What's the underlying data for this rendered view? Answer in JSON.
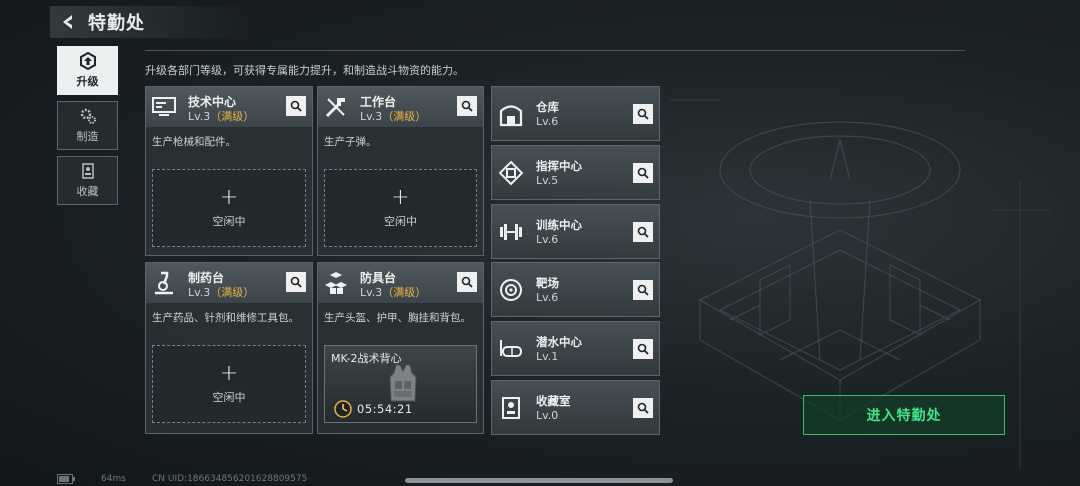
{
  "header": {
    "title": "特勤处"
  },
  "sidebar": {
    "tabs": [
      {
        "label": "升级",
        "icon": "upgrade-icon",
        "active": true
      },
      {
        "label": "制造",
        "icon": "gears-icon",
        "active": false
      },
      {
        "label": "收藏",
        "icon": "collection-icon",
        "active": false
      }
    ]
  },
  "description": "升级各部门等级，可获得专属能力提升，和制造战斗物资的能力。",
  "workshops": [
    {
      "name": "技术中心",
      "level": "Lv.3",
      "max_tag": "（满级）",
      "desc": "生产枪械和配件。",
      "icon": "computer-icon",
      "slot": {
        "plus": "+",
        "status": "空闲中"
      }
    },
    {
      "name": "工作台",
      "level": "Lv.3",
      "max_tag": "（满级）",
      "desc": "生产子弹。",
      "icon": "tools-icon",
      "slot": {
        "plus": "+",
        "status": "空闲中"
      }
    },
    {
      "name": "制药台",
      "level": "Lv.3",
      "max_tag": "（满级）",
      "desc": "生产药品、针剂和维修工具包。",
      "icon": "microscope-icon",
      "slot": {
        "plus": "+",
        "status": "空闲中"
      }
    },
    {
      "name": "防具台",
      "level": "Lv.3",
      "max_tag": "（满级）",
      "desc": "生产头盔、护甲、胸挂和背包。",
      "icon": "armor-blocks-icon",
      "slot": {
        "item": "MK-2战术背心",
        "timer": "05:54:21",
        "icon": "vest-icon"
      }
    }
  ],
  "facilities": [
    {
      "name": "仓库",
      "level": "Lv.6",
      "icon": "warehouse-icon"
    },
    {
      "name": "指挥中心",
      "level": "Lv.5",
      "icon": "command-chip-icon"
    },
    {
      "name": "训练中心",
      "level": "Lv.6",
      "icon": "dumbbell-icon"
    },
    {
      "name": "靶场",
      "level": "Lv.6",
      "icon": "target-icon"
    },
    {
      "name": "潜水中心",
      "level": "Lv.1",
      "icon": "diving-mask-icon"
    },
    {
      "name": "收藏室",
      "level": "Lv.0",
      "icon": "display-case-icon"
    }
  ],
  "enter_button": {
    "label": "进入特勤处"
  },
  "status_bar": {
    "ping": "64ms",
    "uid": "CN UID:18663485620162880957​5"
  },
  "colors": {
    "accent_green": "#43e38a",
    "maxed_gold": "#e8b34a",
    "panel": "#2a3236"
  }
}
